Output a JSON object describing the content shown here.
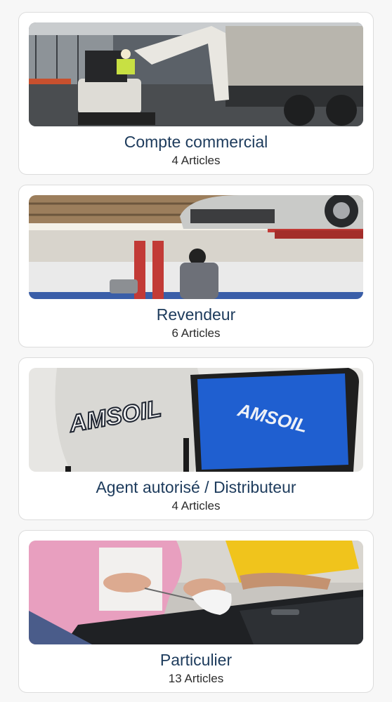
{
  "categories": [
    {
      "title": "Compte commercial",
      "count": "4 Articles",
      "image": "construction-excavator-photo"
    },
    {
      "title": "Revendeur",
      "count": "6 Articles",
      "image": "auto-repair-shop-photo"
    },
    {
      "title": "Agent autorisé / Distributeur",
      "count": "4 Articles",
      "image": "amsoil-cap-and-folder-photo"
    },
    {
      "title": "Particulier",
      "count": "13 Articles",
      "image": "checking-engine-oil-photo"
    }
  ],
  "brand_text": "AMSOIL"
}
